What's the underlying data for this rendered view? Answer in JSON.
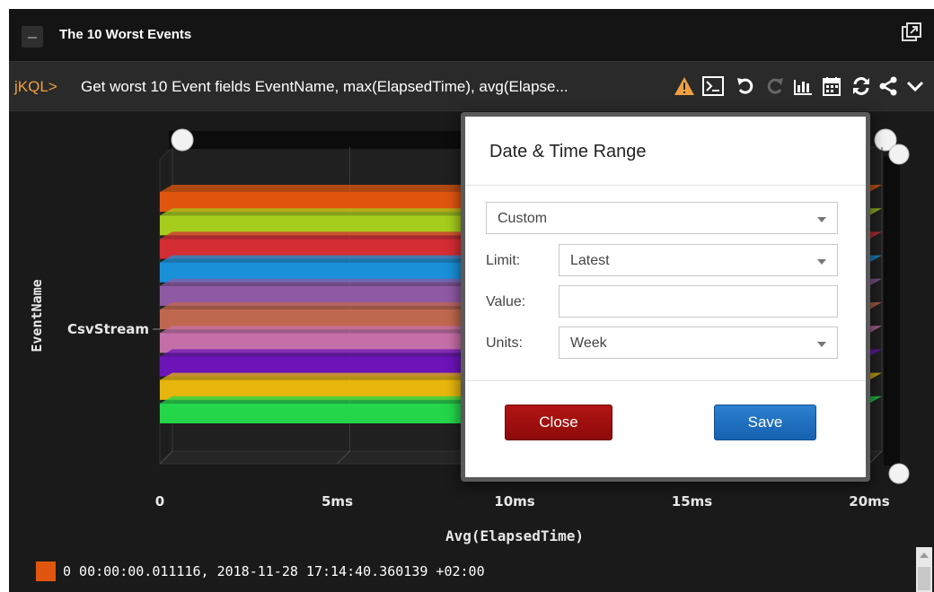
{
  "window": {
    "title": "The 10 Worst Events",
    "icons": [
      "collapse-icon",
      "popout-icon"
    ]
  },
  "query": {
    "prompt": "jKQL>",
    "text": "Get worst 10 Event fields EventName, max(ElapsedTime), avg(Elapse...",
    "toolbar_icons": [
      "warning-icon",
      "terminal-icon",
      "undo-icon",
      "redo-icon",
      "bar-chart-icon",
      "calendar-icon",
      "refresh-icon",
      "share-icon",
      "chevron-down-icon"
    ]
  },
  "colors": {
    "background": "#1a1a1a",
    "accent_prompt": "#f0a040",
    "close_button": "#a00f0f",
    "save_button": "#1f6fc0"
  },
  "chart_data": {
    "type": "bar",
    "orientation": "horizontal",
    "categories": [
      "CsvStream"
    ],
    "xlabel": "Avg(ElapsedTime)",
    "ylabel": "EventName",
    "xticks": [
      "0",
      "5ms",
      "10ms",
      "15ms",
      "20ms"
    ],
    "xlim": [
      0,
      20
    ],
    "grid": true,
    "series_colors": [
      "#e0560f",
      "#a6cc1c",
      "#d42d34",
      "#1990d8",
      "#8e5aa4",
      "#c0684f",
      "#c56fa8",
      "#6c14b8",
      "#e6b60c",
      "#23d64a"
    ],
    "legend": [
      {
        "color": "#e0560f",
        "label": "0 00:00:00.011116, 2018-11-28 17:14:40.360139 +02:00"
      }
    ]
  },
  "dialog": {
    "title": "Date & Time Range",
    "range_type": "Custom",
    "limit_label": "Limit:",
    "limit_value": "Latest",
    "value_label": "Value:",
    "value_value": "",
    "units_label": "Units:",
    "units_value": "Week",
    "close_label": "Close",
    "save_label": "Save"
  }
}
